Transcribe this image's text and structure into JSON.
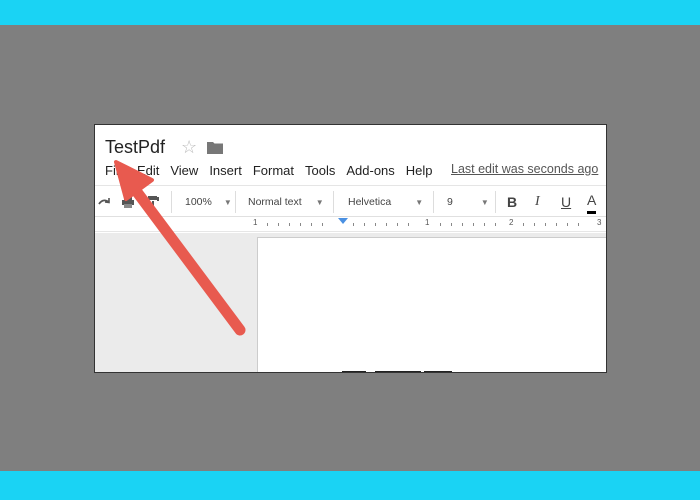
{
  "document": {
    "title": "TestPdf",
    "last_edit": "Last edit was seconds ago"
  },
  "menu": {
    "items": [
      "File",
      "Edit",
      "View",
      "Insert",
      "Format",
      "Tools",
      "Add-ons",
      "Help"
    ]
  },
  "toolbar": {
    "zoom": "100%",
    "style": "Normal text",
    "font": "Helvetica",
    "size": "9",
    "bold_label": "B",
    "italic_label": "I",
    "underline_label": "U",
    "text_color_label": "A"
  },
  "ruler": {
    "labels": [
      "1",
      "1",
      "2",
      "3"
    ]
  },
  "colors": {
    "band": "#1ad3f4",
    "backdrop": "#7f7f7f",
    "arrow": "#e85a4f"
  }
}
